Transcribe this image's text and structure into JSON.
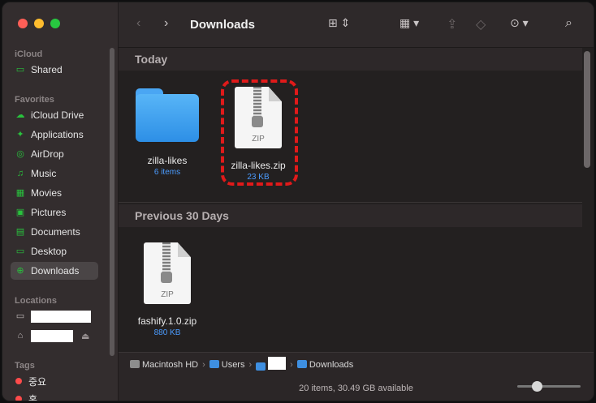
{
  "window": {
    "title": "Downloads"
  },
  "sidebar": {
    "sections": {
      "icloud": "iCloud",
      "favorites": "Favorites",
      "locations": "Locations",
      "tags": "Tags"
    },
    "icloud_items": [
      {
        "label": "Shared",
        "icon": "shared-folder-icon"
      }
    ],
    "favorites": [
      {
        "label": "iCloud Drive",
        "icon": "cloud-icon"
      },
      {
        "label": "Applications",
        "icon": "applications-icon"
      },
      {
        "label": "AirDrop",
        "icon": "airdrop-icon"
      },
      {
        "label": "Music",
        "icon": "music-icon"
      },
      {
        "label": "Movies",
        "icon": "movies-icon"
      },
      {
        "label": "Pictures",
        "icon": "pictures-icon"
      },
      {
        "label": "Documents",
        "icon": "documents-icon"
      },
      {
        "label": "Desktop",
        "icon": "desktop-icon"
      },
      {
        "label": "Downloads",
        "icon": "downloads-icon",
        "selected": true
      }
    ],
    "tags": [
      {
        "label": "중요",
        "color": "#ff4b4b"
      },
      {
        "label": "혹",
        "color": "#ff4b4b"
      }
    ]
  },
  "toolbar": {
    "title": "Downloads"
  },
  "sections": [
    {
      "title": "Today",
      "items": [
        {
          "name": "zilla-likes",
          "meta": "6 items",
          "kind": "folder"
        },
        {
          "name": "zilla-likes.zip",
          "meta": "23 KB",
          "kind": "zip",
          "highlighted": true
        }
      ]
    },
    {
      "title": "Previous 30 Days",
      "items": [
        {
          "name": "fashify.1.0.zip",
          "meta": "880 KB",
          "kind": "zip"
        }
      ]
    }
  ],
  "zip_label": "ZIP",
  "pathbar": {
    "hd": "Macintosh HD",
    "users": "Users",
    "downloads": "Downloads",
    "separator": "›"
  },
  "status": {
    "text": "20 items, 30.49 GB available"
  },
  "colors": {
    "accent": "#4b9cff",
    "sidebar_icon": "#29c23d",
    "highlight": "#e01a1a"
  }
}
